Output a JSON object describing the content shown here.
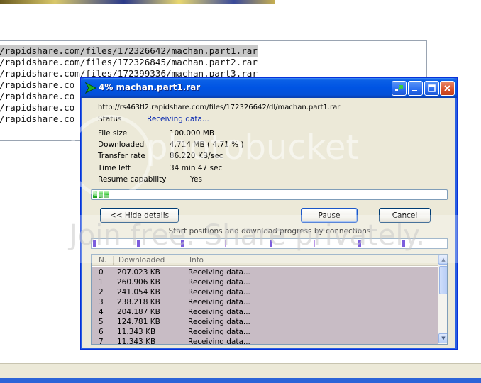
{
  "background": {
    "url_lines": [
      "/rapidshare.com/files/172326642/machan.part1.rar",
      "/rapidshare.com/files/172326845/machan.part2.rar",
      "/rapidshare.com/files/172399336/machan.part3.rar",
      "/rapidshare.co",
      "/rapidshare.co",
      "/rapidshare.co",
      "/rapidshare.co"
    ]
  },
  "window": {
    "title": "4% machan.part1.rar",
    "url": "http://rs463tl2.rapidshare.com/files/172326642/dl/machan.part1.rar",
    "status_label": "Status",
    "status_value": "Receiving data...",
    "fields": [
      {
        "label": "File size",
        "value": "100.000  MB"
      },
      {
        "label": "Downloaded",
        "value": "4.714  MB  ( 4.71 % )"
      },
      {
        "label": "Transfer rate",
        "value": "86.220  KB/sec"
      },
      {
        "label": "Time left",
        "value": "34 min 47 sec"
      }
    ],
    "resume_label": "Resume capability",
    "resume_value": "Yes",
    "progress_fraction": 0.047,
    "buttons": {
      "hide_details": "<< Hide details",
      "pause": "Pause",
      "cancel": "Cancel"
    },
    "connections_caption": "Start positions and download progress by connections",
    "table": {
      "headers": [
        "N.",
        "Downloaded",
        "Info"
      ],
      "rows": [
        {
          "n": "0",
          "downloaded": "207.023  KB",
          "info": "Receiving data..."
        },
        {
          "n": "1",
          "downloaded": "260.906  KB",
          "info": "Receiving data..."
        },
        {
          "n": "2",
          "downloaded": "241.054  KB",
          "info": "Receiving data..."
        },
        {
          "n": "3",
          "downloaded": "238.218  KB",
          "info": "Receiving data..."
        },
        {
          "n": "4",
          "downloaded": "204.187  KB",
          "info": "Receiving data..."
        },
        {
          "n": "5",
          "downloaded": "124.781  KB",
          "info": "Receiving data..."
        },
        {
          "n": "6",
          "downloaded": "11.343  KB",
          "info": "Receiving data..."
        },
        {
          "n": "7",
          "downloaded": "11.343  KB",
          "info": "Receiving data..."
        }
      ]
    }
  },
  "watermark": {
    "logo_text": "photobucket",
    "tagline": "Join free. Share privately."
  },
  "colors": {
    "titlebar": "#0054e3",
    "progress_fill": "#2bc22b",
    "connection_marker": "#4a1fd0",
    "table_bg": "#c8bcc5"
  }
}
